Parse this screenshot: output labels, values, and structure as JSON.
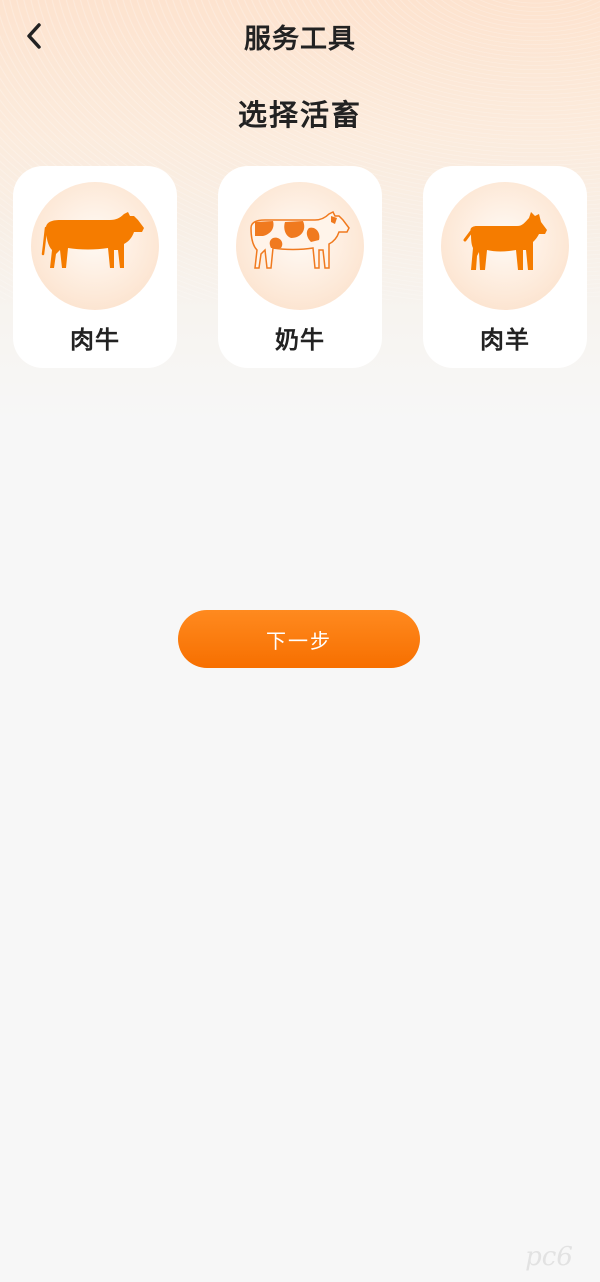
{
  "header": {
    "title": "服务工具"
  },
  "section": {
    "title": "选择活畜"
  },
  "livestock": [
    {
      "label": "肉牛",
      "icon": "beef-cattle-icon"
    },
    {
      "label": "奶牛",
      "icon": "dairy-cow-icon"
    },
    {
      "label": "肉羊",
      "icon": "sheep-icon"
    }
  ],
  "next_button": {
    "label": "下一步"
  },
  "watermark": {
    "text": "pc6"
  },
  "colors": {
    "accent": "#f97a08",
    "cow_spot": "#f07a1f",
    "icon_bg": "#fde9d8",
    "text": "#222222"
  }
}
